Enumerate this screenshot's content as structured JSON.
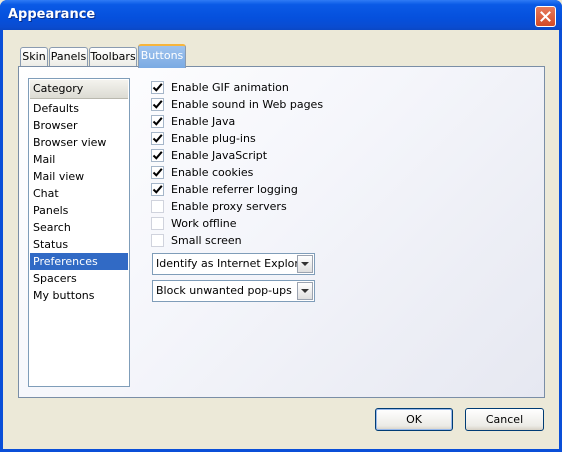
{
  "window": {
    "title": "Appearance"
  },
  "tabs": [
    {
      "label": "Skin"
    },
    {
      "label": "Panels"
    },
    {
      "label": "Toolbars"
    },
    {
      "label": "Buttons",
      "active": true
    }
  ],
  "category": {
    "header": "Category",
    "items": [
      {
        "label": "Defaults"
      },
      {
        "label": "Browser"
      },
      {
        "label": "Browser view"
      },
      {
        "label": "Mail"
      },
      {
        "label": "Mail view"
      },
      {
        "label": "Chat"
      },
      {
        "label": "Panels"
      },
      {
        "label": "Search"
      },
      {
        "label": "Status"
      },
      {
        "label": "Preferences",
        "selected": true
      },
      {
        "label": "Spacers"
      },
      {
        "label": "My buttons"
      }
    ]
  },
  "options": [
    {
      "label": "Enable GIF animation",
      "checked": true
    },
    {
      "label": "Enable sound in Web pages",
      "checked": true
    },
    {
      "label": "Enable Java",
      "checked": true
    },
    {
      "label": "Enable plug-ins",
      "checked": true
    },
    {
      "label": "Enable JavaScript",
      "checked": true
    },
    {
      "label": "Enable cookies",
      "checked": true
    },
    {
      "label": "Enable referrer logging",
      "checked": true
    },
    {
      "label": "Enable proxy servers",
      "checked": false
    },
    {
      "label": "Work offline",
      "checked": false
    },
    {
      "label": "Small screen",
      "checked": false
    }
  ],
  "dropdowns": [
    {
      "value": "Identify as Internet Explorer"
    },
    {
      "value": "Block unwanted pop-ups"
    }
  ],
  "buttons": {
    "ok": "OK",
    "cancel": "Cancel"
  },
  "colors": {
    "titlebar": "#0550dd",
    "selection": "#316ac5",
    "close": "#d34a26"
  }
}
